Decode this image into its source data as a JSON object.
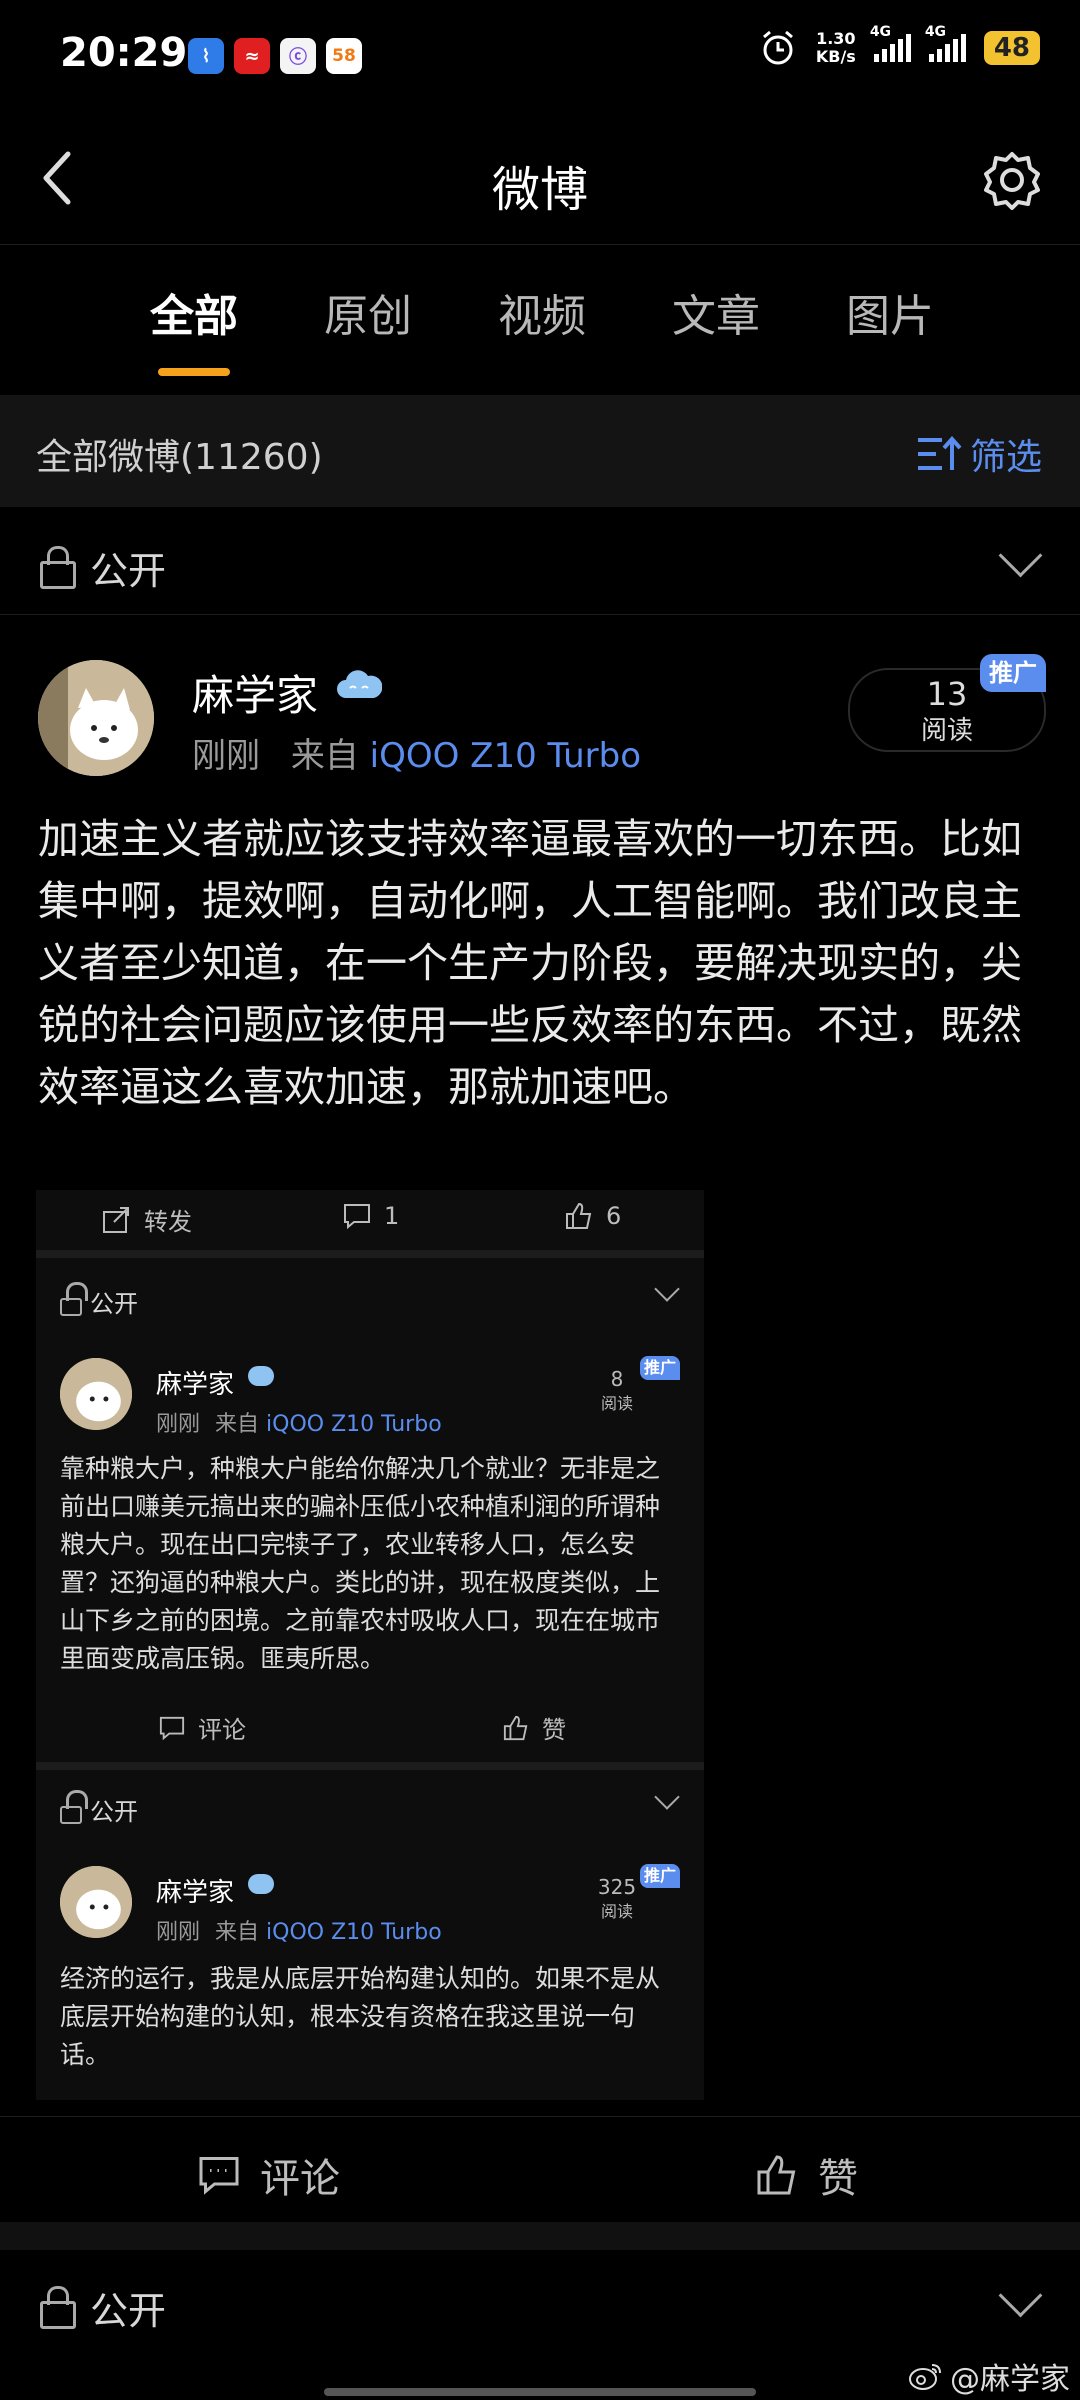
{
  "status_bar": {
    "time": "20:29",
    "net_speed_value": "1.30",
    "net_speed_unit": "KB/s",
    "network_1": "4G",
    "network_2": "4G",
    "battery": "48",
    "app_icons": [
      "app-icon-blue",
      "app-icon-red",
      "app-icon-white",
      "58"
    ]
  },
  "header": {
    "title": "微博"
  },
  "tabs": [
    {
      "label": "全部"
    },
    {
      "label": "原创"
    },
    {
      "label": "视频"
    },
    {
      "label": "文章"
    },
    {
      "label": "图片"
    }
  ],
  "filter": {
    "count_label": "全部微博(11260)",
    "filter_label": "筛选"
  },
  "post": {
    "visibility": "公开",
    "author": "麻学家",
    "time": "刚刚",
    "source_prefix": "来自",
    "source": "iQOO Z10 Turbo",
    "read_count": "13",
    "read_label": "阅读",
    "promo_badge": "推广",
    "content": "加速主义者就应该支持效率逼最喜欢的一切东西。比如集中啊，提效啊，自动化啊，人工智能啊。我们改良主义者至少知道，在一个生产力阶段，要解决现实的，尖锐的社会问题应该使用一些反效率的东西。不过，既然效率逼这么喜欢加速，那就加速吧。",
    "repost_label": "转发",
    "comment_count": "1",
    "like_count": "6"
  },
  "embedded_1": {
    "visibility": "公开",
    "author": "麻学家",
    "time": "刚刚",
    "source_prefix": "来自",
    "source": "iQOO Z10 Turbo",
    "read_count": "8",
    "read_label": "阅读",
    "promo_badge": "推广",
    "content": "靠种粮大户，种粮大户能给你解决几个就业？无非是之前出口赚美元搞出来的骗补压低小农种植利润的所谓种粮大户。现在出口完犊子了，农业转移人口，怎么安置？还狗逼的种粮大户。类比的讲，现在极度类似，上山下乡之前的困境。之前靠农村吸收人口，现在在城市里面变成高压锅。匪夷所思。",
    "comment_label": "评论",
    "like_label": "赞"
  },
  "embedded_2": {
    "visibility": "公开",
    "author": "麻学家",
    "time": "刚刚",
    "source_prefix": "来自",
    "source": "iQOO Z10 Turbo",
    "read_count": "325",
    "read_label": "阅读",
    "promo_badge": "推广",
    "content": "经济的运行，我是从底层开始构建认知的。如果不是从底层开始构建的认知，根本没有资格在我这里说一句话。"
  },
  "bottom_actions": {
    "comment_label": "评论",
    "like_label": "赞"
  },
  "next_post": {
    "visibility": "公开"
  },
  "watermark": "@麻学家"
}
